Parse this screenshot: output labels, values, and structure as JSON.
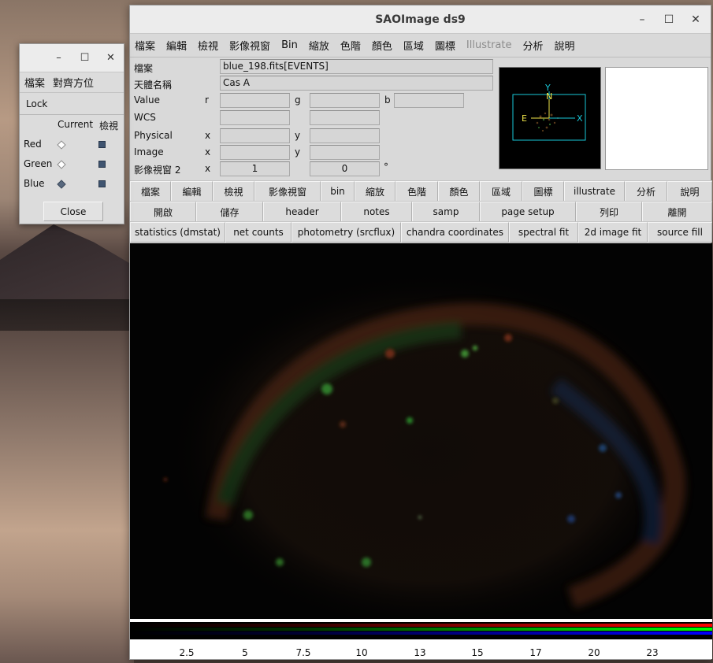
{
  "dialog": {
    "menu": [
      "檔案",
      "對齊方位"
    ],
    "lock": "Lock",
    "col_current": "Current",
    "col_view": "檢視",
    "channels": [
      {
        "name": "Red",
        "current": false
      },
      {
        "name": "Green",
        "current": false
      },
      {
        "name": "Blue",
        "current": true
      }
    ],
    "close": "Close",
    "controls": {
      "minimize": "–",
      "maximize": "☐",
      "close": "✕"
    }
  },
  "window": {
    "title": "SAOImage ds9",
    "controls": {
      "minimize": "–",
      "maximize": "☐",
      "close": "✕"
    }
  },
  "menubar": [
    "檔案",
    "編輯",
    "檢視",
    "影像視窗",
    "Bin",
    "縮放",
    "色階",
    "顏色",
    "區域",
    "圖標",
    "Illustrate",
    "分析",
    "說明"
  ],
  "info": {
    "file_label": "檔案",
    "file_value": "blue_198.fits[EVENTS]",
    "object_label": "天體名稱",
    "object_value": "Cas A",
    "value_label": "Value",
    "r": "r",
    "g": "g",
    "b": "b",
    "wcs_label": "WCS",
    "physical_label": "Physical",
    "image_label": "Image",
    "frame_label": "影像視窗 2",
    "x": "x",
    "y": "y",
    "frame_x": "1",
    "frame_y": "0",
    "degree": "°"
  },
  "panner": {
    "n": "N",
    "e": "E",
    "y": "Y",
    "x": "X"
  },
  "buttonbar_main": [
    "檔案",
    "編輯",
    "檢視",
    "影像視窗",
    "bin",
    "縮放",
    "色階",
    "顏色",
    "區域",
    "圖標",
    "illustrate",
    "分析",
    "說明"
  ],
  "buttonbar_file": [
    "開啟",
    "儲存",
    "header",
    "notes",
    "samp",
    "page setup",
    "列印",
    "離開"
  ],
  "buttonbar_analysis": [
    "statistics (dmstat)",
    "net counts",
    "photometry (srcflux)",
    "chandra coordinates",
    "spectral fit",
    "2d image fit",
    "source fill"
  ],
  "colorbar": {
    "ticks": [
      "2.5",
      "5",
      "7.5",
      "10",
      "13",
      "15",
      "17",
      "20",
      "23"
    ]
  },
  "colors": {
    "red": "#ff0000",
    "green": "#00ff00",
    "blue": "#0000ff"
  }
}
